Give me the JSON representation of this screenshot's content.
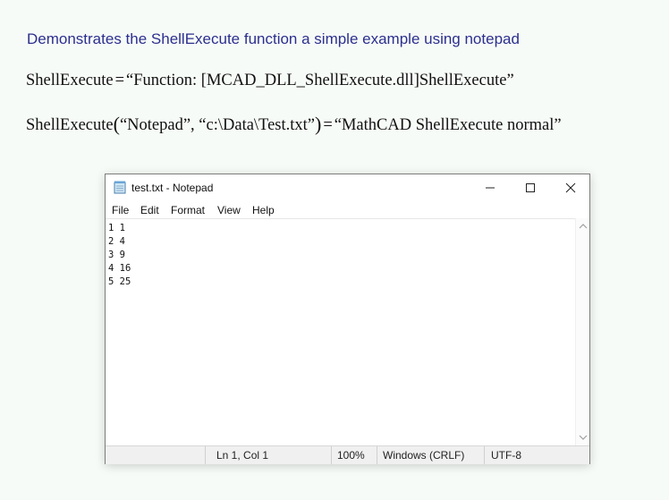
{
  "heading": "Demonstrates the ShellExecute function a simple example using notepad",
  "math": {
    "line1": {
      "lhs": "ShellExecute",
      "op": "=",
      "rhs": "“Function: [MCAD_DLL_ShellExecute.dll]ShellExecute”"
    },
    "line2": {
      "func": "ShellExecute",
      "open_paren": "(",
      "arg1": "“Notepad”",
      "comma": ",",
      "arg2": "“c:\\Data\\Test.txt”",
      "close_paren": ")",
      "op": "=",
      "result": "“MathCAD ShellExecute normal”"
    }
  },
  "notepad": {
    "title": "test.txt - Notepad",
    "menu": [
      "File",
      "Edit",
      "Format",
      "View",
      "Help"
    ],
    "content": "1 1\n2 4\n3 9\n4 16\n5 25",
    "status": {
      "position": "Ln 1, Col 1",
      "zoom": "100%",
      "line_ending": "Windows (CRLF)",
      "encoding": "UTF-8"
    }
  },
  "colors": {
    "heading": "#2b2f8f",
    "background": "#f7fbf7",
    "statusbar": "#f0f0f0"
  }
}
